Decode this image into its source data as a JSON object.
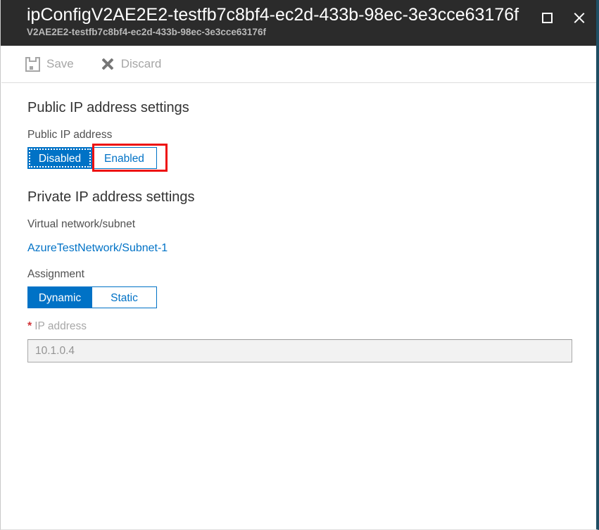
{
  "header": {
    "title": "ipConfigV2AE2E2-testfb7c8bf4-ec2d-433b-98ec-3e3cce63176f",
    "subtitle": "V2AE2E2-testfb7c8bf4-ec2d-433b-98ec-3e3cce63176f",
    "restore_icon": "restore-window-icon",
    "close_icon": "close-icon",
    "background_color": "#2b2b2b",
    "title_color": "#ffffff",
    "subtitle_color": "#b9b9b9"
  },
  "command_bar": {
    "save": {
      "label": "Save",
      "icon": "save-floppy-icon",
      "enabled": false
    },
    "discard": {
      "label": "Discard",
      "icon": "discard-x-icon",
      "enabled": false
    },
    "disabled_color": "#a6a6a6"
  },
  "public_ip_section": {
    "heading": "Public IP address settings",
    "field_label": "Public IP address",
    "options": [
      {
        "label": "Disabled",
        "selected": true,
        "focused": true
      },
      {
        "label": "Enabled",
        "selected": false,
        "focused": false
      }
    ],
    "annotation_color": "#ee1111"
  },
  "private_ip_section": {
    "heading": "Private IP address settings",
    "vnet_subnet_label": "Virtual network/subnet",
    "vnet_subnet_value": "AzureTestNetwork/Subnet-1",
    "assignment_label": "Assignment",
    "assignment_options": [
      {
        "label": "Dynamic",
        "selected": true
      },
      {
        "label": "Static",
        "selected": false
      }
    ],
    "ip_address_label": "IP address",
    "ip_address_required_marker": "*",
    "ip_address_value": "10.1.0.4",
    "ip_address_enabled": false
  },
  "theme": {
    "accent_blue": "#0072c6",
    "link_blue": "#0072c6",
    "required_red": "#d13438",
    "edge_accent": "#1f4e63"
  }
}
